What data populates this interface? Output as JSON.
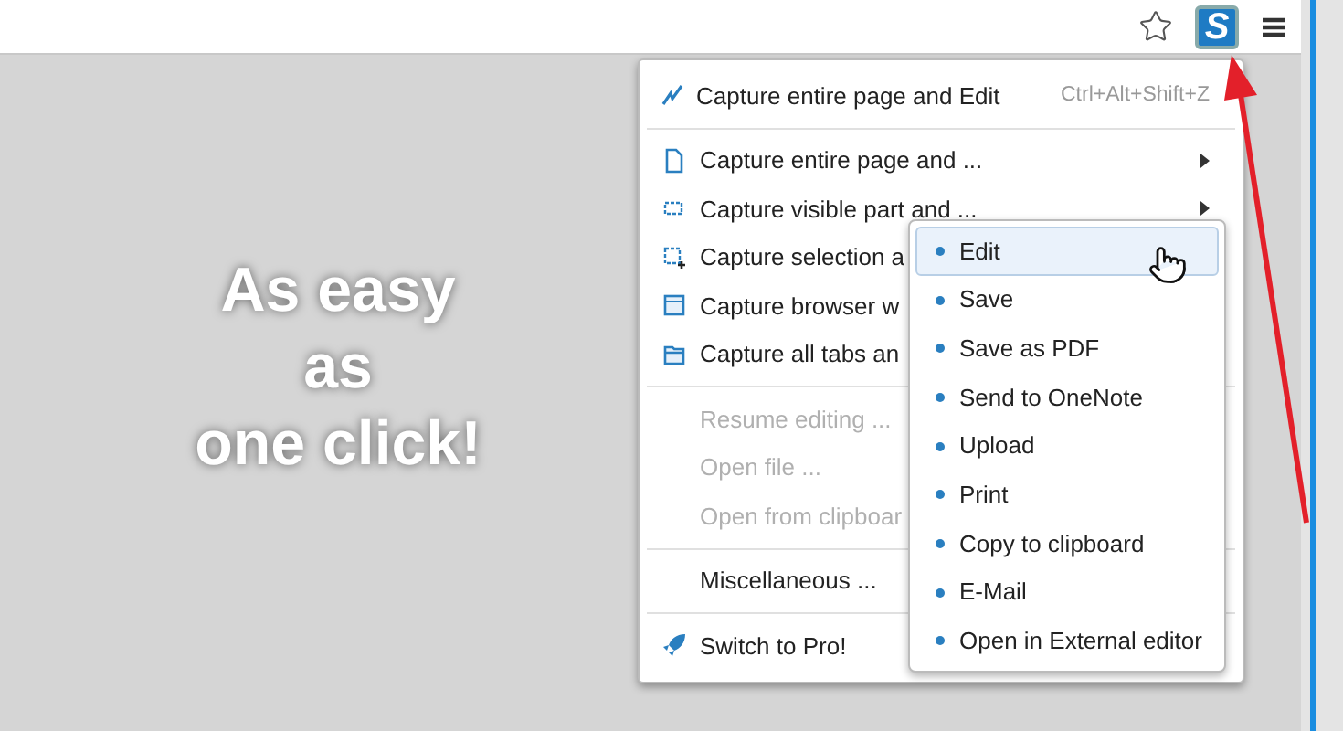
{
  "toolbar": {
    "extension_label": "S"
  },
  "slogan": [
    "As easy",
    "as",
    "one click!"
  ],
  "menu": {
    "groups": [
      [
        {
          "label": "Capture entire page and Edit",
          "shortcut": "Ctrl+Alt+Shift+Z",
          "has_submenu": false,
          "disabled": false
        }
      ],
      [
        {
          "label": "Capture entire page and ...",
          "has_submenu": true,
          "disabled": false
        },
        {
          "label": "Capture visible part and ...",
          "has_submenu": true,
          "disabled": false
        },
        {
          "label": "Capture selection a",
          "has_submenu": false,
          "disabled": false
        },
        {
          "label": "Capture browser w",
          "has_submenu": false,
          "disabled": false
        },
        {
          "label": "Capture all tabs an",
          "has_submenu": false,
          "disabled": false
        }
      ],
      [
        {
          "label": "Resume editing ...",
          "has_submenu": false,
          "disabled": true
        },
        {
          "label": "Open file ...",
          "has_submenu": false,
          "disabled": true
        },
        {
          "label": "Open from clipboar",
          "has_submenu": false,
          "disabled": true
        }
      ],
      [
        {
          "label": "Miscellaneous ...",
          "has_submenu": false,
          "disabled": false
        }
      ],
      [
        {
          "label": "Switch to Pro!",
          "has_submenu": false,
          "disabled": false
        }
      ]
    ]
  },
  "submenu": {
    "items": [
      {
        "label": "Edit",
        "selected": true
      },
      {
        "label": "Save",
        "selected": false
      },
      {
        "label": "Save as PDF",
        "selected": false
      },
      {
        "label": "Send to OneNote",
        "selected": false
      },
      {
        "label": "Upload",
        "selected": false
      },
      {
        "label": "Print",
        "selected": false
      },
      {
        "label": "Copy to clipboard",
        "selected": false
      },
      {
        "label": "E-Mail",
        "selected": false
      },
      {
        "label": "Open in External editor",
        "selected": false
      }
    ]
  }
}
